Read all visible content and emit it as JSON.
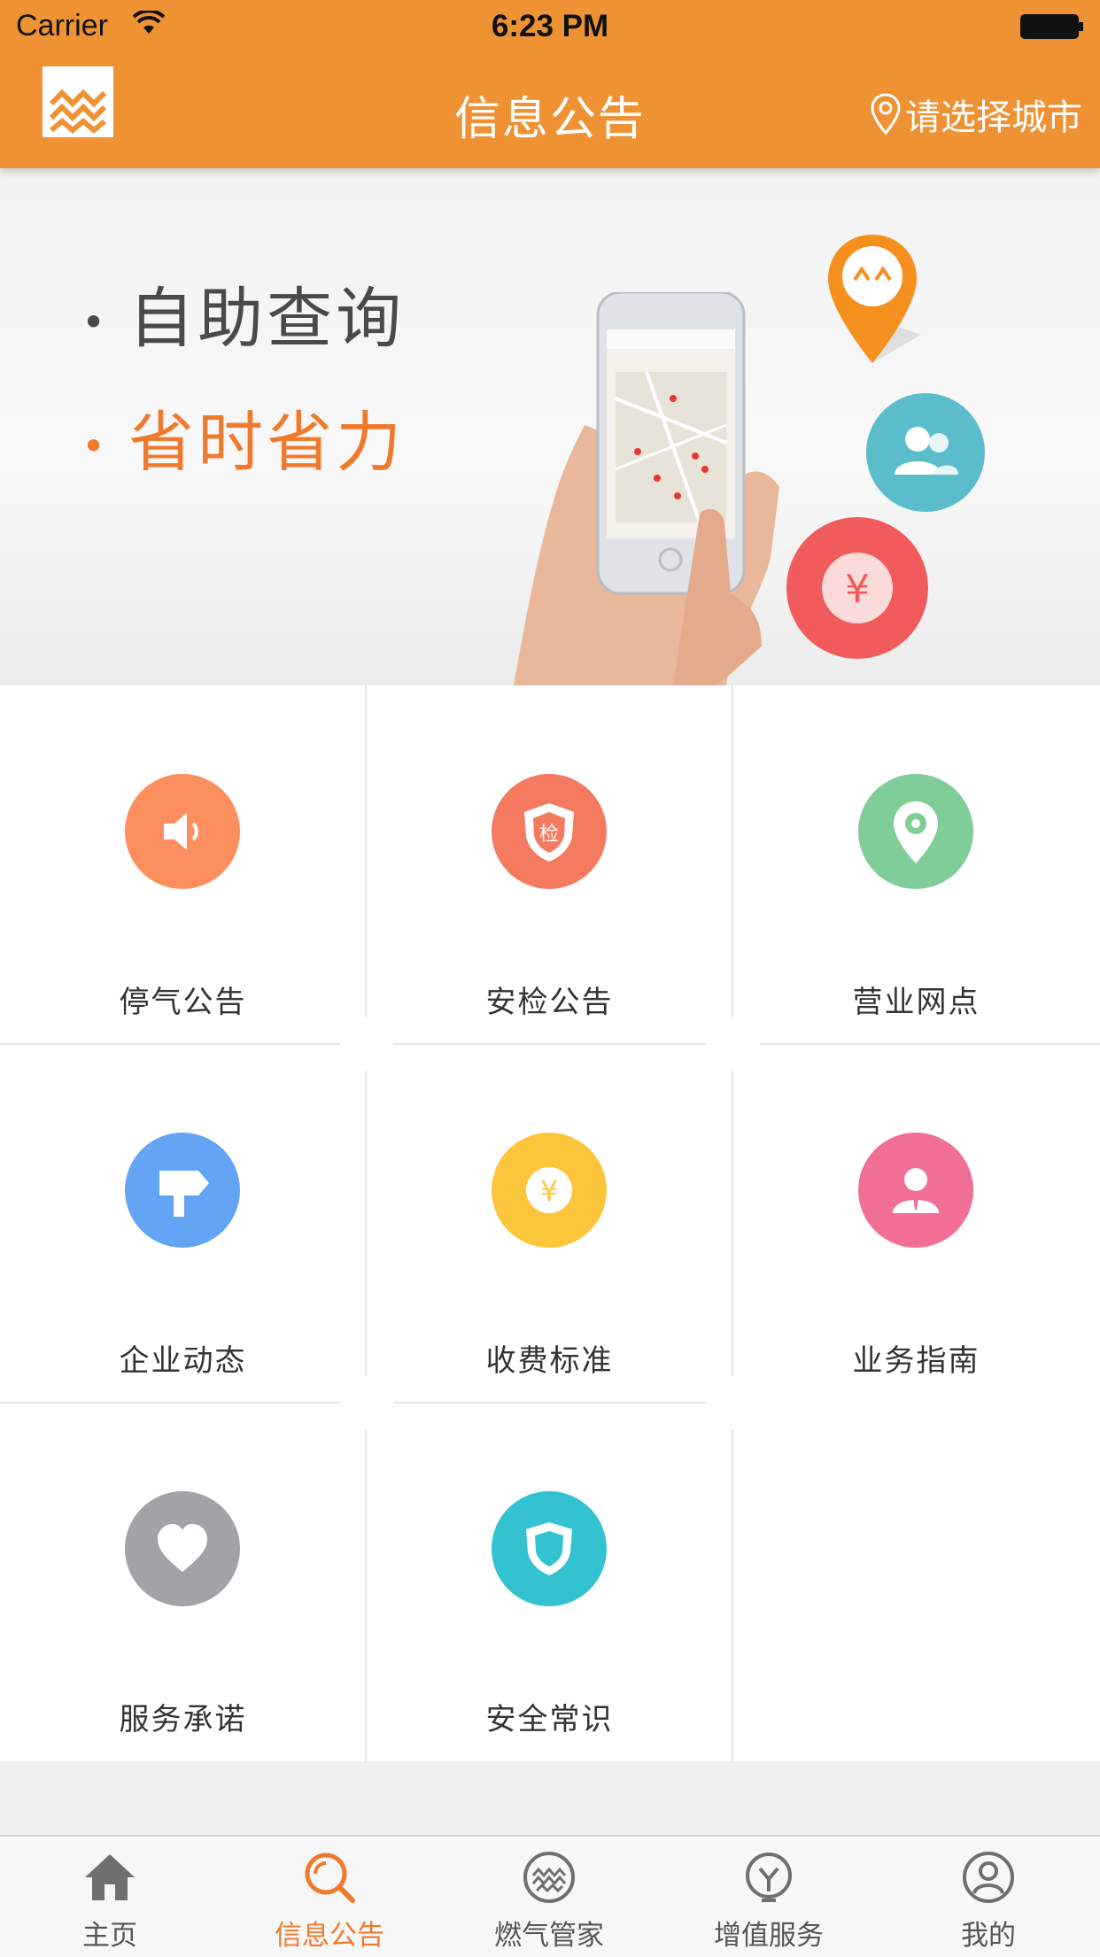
{
  "status_bar": {
    "carrier": "Carrier",
    "time": "6:23 PM"
  },
  "nav": {
    "title": "信息公告",
    "city_label": "请选择城市"
  },
  "banner": {
    "line1": "自助查询",
    "line2": "省时省力"
  },
  "grid": [
    {
      "label": "停气公告",
      "icon": "speaker-icon",
      "color": "#fd8f5e"
    },
    {
      "label": "安检公告",
      "icon": "inspection-shield-icon",
      "color": "#f47a60"
    },
    {
      "label": "营业网点",
      "icon": "location-pin-icon",
      "color": "#7fcd99"
    },
    {
      "label": "企业动态",
      "icon": "signpost-icon",
      "color": "#63a5f4"
    },
    {
      "label": "收费标准",
      "icon": "yuan-coin-icon",
      "color": "#fdc53c"
    },
    {
      "label": "业务指南",
      "icon": "person-icon",
      "color": "#f16e95"
    },
    {
      "label": "服务承诺",
      "icon": "heart-icon",
      "color": "#a2a3a7"
    },
    {
      "label": "安全常识",
      "icon": "safety-shield-icon",
      "color": "#33c2d0"
    }
  ],
  "tabs": [
    {
      "label": "主页",
      "icon": "home-icon",
      "active": false
    },
    {
      "label": "信息公告",
      "icon": "search-icon",
      "active": true
    },
    {
      "label": "燃气管家",
      "icon": "gas-icon",
      "active": false
    },
    {
      "label": "增值服务",
      "icon": "bulb-icon",
      "active": false
    },
    {
      "label": "我的",
      "icon": "profile-icon",
      "active": false
    }
  ],
  "colors": {
    "accent": "#ee9233",
    "active_tab": "#ef7a2c"
  }
}
